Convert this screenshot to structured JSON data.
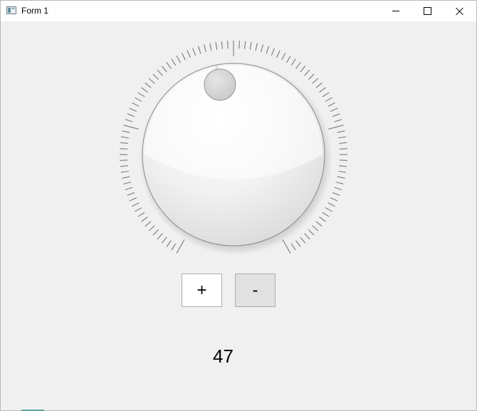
{
  "window": {
    "title": "Form 1",
    "controls": {
      "minimize": "minimize-icon",
      "maximize": "maximize-icon",
      "close": "close-icon"
    }
  },
  "dial": {
    "value": 47,
    "min": 0,
    "max": 100,
    "sweep_degrees": 300,
    "pointer_angle_degrees": -11
  },
  "buttons": {
    "increment_label": "+",
    "decrement_label": "-"
  },
  "readout": "47",
  "colors": {
    "window_background": "#f0f0f0",
    "titlebar": "#ffffff",
    "tick": "#6e6e6e",
    "knob_edge": "#8a8a8a"
  }
}
